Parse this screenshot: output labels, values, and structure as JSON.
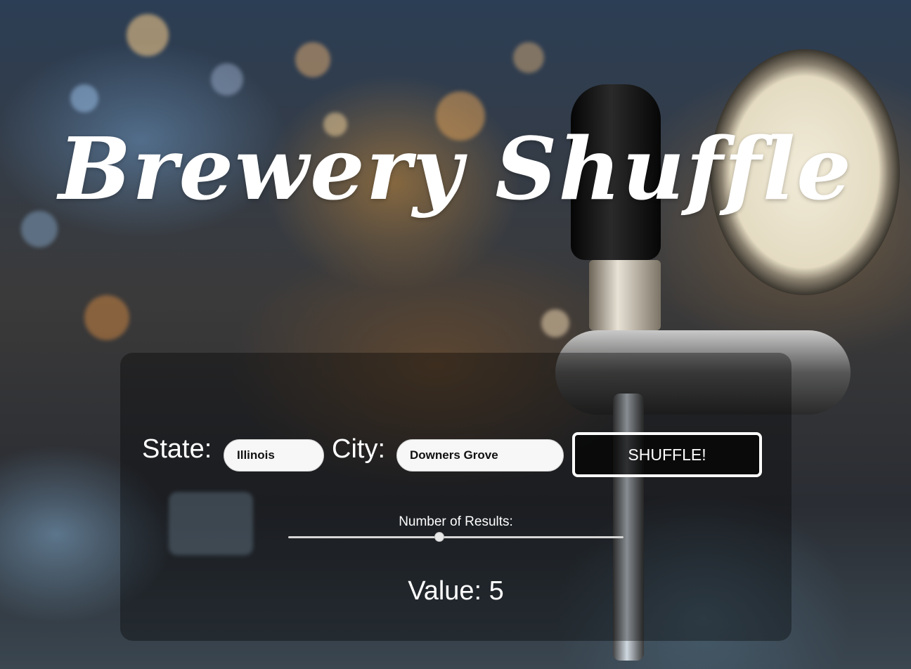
{
  "app": {
    "title": "Brewery Shuffle"
  },
  "form": {
    "state_label": "State:",
    "state_value": "Illinois",
    "city_label": "City:",
    "city_value": "Downers Grove",
    "shuffle_label": "SHUFFLE!"
  },
  "results": {
    "slider_label": "Number of Results:",
    "slider_fraction": 0.45,
    "value_text": "Value: 5"
  },
  "colors": {
    "text": "#ffffff",
    "panel_overlay": "rgba(0,0,0,0.35)",
    "button_border": "#ffffff"
  }
}
